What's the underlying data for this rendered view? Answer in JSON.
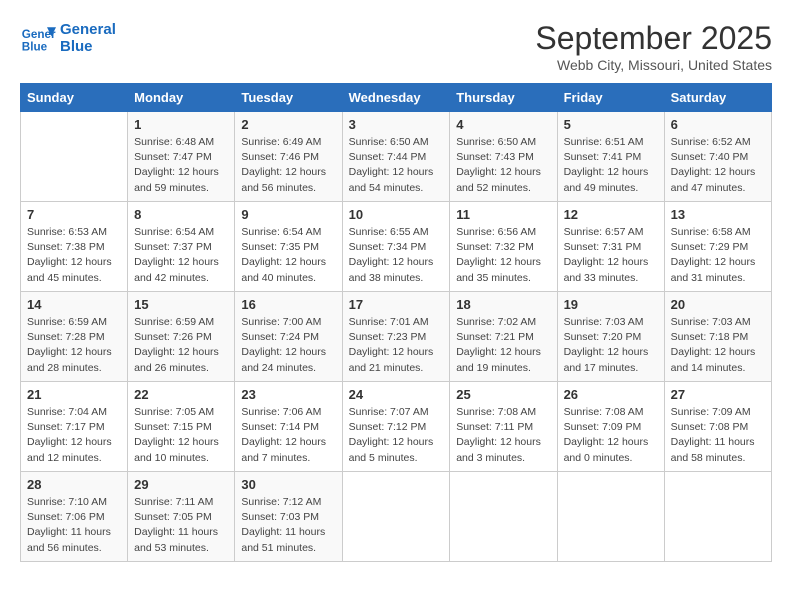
{
  "header": {
    "logo_line1": "General",
    "logo_line2": "Blue",
    "month": "September 2025",
    "location": "Webb City, Missouri, United States"
  },
  "days_of_week": [
    "Sunday",
    "Monday",
    "Tuesday",
    "Wednesday",
    "Thursday",
    "Friday",
    "Saturday"
  ],
  "weeks": [
    [
      {
        "day": "",
        "info": ""
      },
      {
        "day": "1",
        "info": "Sunrise: 6:48 AM\nSunset: 7:47 PM\nDaylight: 12 hours\nand 59 minutes."
      },
      {
        "day": "2",
        "info": "Sunrise: 6:49 AM\nSunset: 7:46 PM\nDaylight: 12 hours\nand 56 minutes."
      },
      {
        "day": "3",
        "info": "Sunrise: 6:50 AM\nSunset: 7:44 PM\nDaylight: 12 hours\nand 54 minutes."
      },
      {
        "day": "4",
        "info": "Sunrise: 6:50 AM\nSunset: 7:43 PM\nDaylight: 12 hours\nand 52 minutes."
      },
      {
        "day": "5",
        "info": "Sunrise: 6:51 AM\nSunset: 7:41 PM\nDaylight: 12 hours\nand 49 minutes."
      },
      {
        "day": "6",
        "info": "Sunrise: 6:52 AM\nSunset: 7:40 PM\nDaylight: 12 hours\nand 47 minutes."
      }
    ],
    [
      {
        "day": "7",
        "info": "Sunrise: 6:53 AM\nSunset: 7:38 PM\nDaylight: 12 hours\nand 45 minutes."
      },
      {
        "day": "8",
        "info": "Sunrise: 6:54 AM\nSunset: 7:37 PM\nDaylight: 12 hours\nand 42 minutes."
      },
      {
        "day": "9",
        "info": "Sunrise: 6:54 AM\nSunset: 7:35 PM\nDaylight: 12 hours\nand 40 minutes."
      },
      {
        "day": "10",
        "info": "Sunrise: 6:55 AM\nSunset: 7:34 PM\nDaylight: 12 hours\nand 38 minutes."
      },
      {
        "day": "11",
        "info": "Sunrise: 6:56 AM\nSunset: 7:32 PM\nDaylight: 12 hours\nand 35 minutes."
      },
      {
        "day": "12",
        "info": "Sunrise: 6:57 AM\nSunset: 7:31 PM\nDaylight: 12 hours\nand 33 minutes."
      },
      {
        "day": "13",
        "info": "Sunrise: 6:58 AM\nSunset: 7:29 PM\nDaylight: 12 hours\nand 31 minutes."
      }
    ],
    [
      {
        "day": "14",
        "info": "Sunrise: 6:59 AM\nSunset: 7:28 PM\nDaylight: 12 hours\nand 28 minutes."
      },
      {
        "day": "15",
        "info": "Sunrise: 6:59 AM\nSunset: 7:26 PM\nDaylight: 12 hours\nand 26 minutes."
      },
      {
        "day": "16",
        "info": "Sunrise: 7:00 AM\nSunset: 7:24 PM\nDaylight: 12 hours\nand 24 minutes."
      },
      {
        "day": "17",
        "info": "Sunrise: 7:01 AM\nSunset: 7:23 PM\nDaylight: 12 hours\nand 21 minutes."
      },
      {
        "day": "18",
        "info": "Sunrise: 7:02 AM\nSunset: 7:21 PM\nDaylight: 12 hours\nand 19 minutes."
      },
      {
        "day": "19",
        "info": "Sunrise: 7:03 AM\nSunset: 7:20 PM\nDaylight: 12 hours\nand 17 minutes."
      },
      {
        "day": "20",
        "info": "Sunrise: 7:03 AM\nSunset: 7:18 PM\nDaylight: 12 hours\nand 14 minutes."
      }
    ],
    [
      {
        "day": "21",
        "info": "Sunrise: 7:04 AM\nSunset: 7:17 PM\nDaylight: 12 hours\nand 12 minutes."
      },
      {
        "day": "22",
        "info": "Sunrise: 7:05 AM\nSunset: 7:15 PM\nDaylight: 12 hours\nand 10 minutes."
      },
      {
        "day": "23",
        "info": "Sunrise: 7:06 AM\nSunset: 7:14 PM\nDaylight: 12 hours\nand 7 minutes."
      },
      {
        "day": "24",
        "info": "Sunrise: 7:07 AM\nSunset: 7:12 PM\nDaylight: 12 hours\nand 5 minutes."
      },
      {
        "day": "25",
        "info": "Sunrise: 7:08 AM\nSunset: 7:11 PM\nDaylight: 12 hours\nand 3 minutes."
      },
      {
        "day": "26",
        "info": "Sunrise: 7:08 AM\nSunset: 7:09 PM\nDaylight: 12 hours\nand 0 minutes."
      },
      {
        "day": "27",
        "info": "Sunrise: 7:09 AM\nSunset: 7:08 PM\nDaylight: 11 hours\nand 58 minutes."
      }
    ],
    [
      {
        "day": "28",
        "info": "Sunrise: 7:10 AM\nSunset: 7:06 PM\nDaylight: 11 hours\nand 56 minutes."
      },
      {
        "day": "29",
        "info": "Sunrise: 7:11 AM\nSunset: 7:05 PM\nDaylight: 11 hours\nand 53 minutes."
      },
      {
        "day": "30",
        "info": "Sunrise: 7:12 AM\nSunset: 7:03 PM\nDaylight: 11 hours\nand 51 minutes."
      },
      {
        "day": "",
        "info": ""
      },
      {
        "day": "",
        "info": ""
      },
      {
        "day": "",
        "info": ""
      },
      {
        "day": "",
        "info": ""
      }
    ]
  ]
}
